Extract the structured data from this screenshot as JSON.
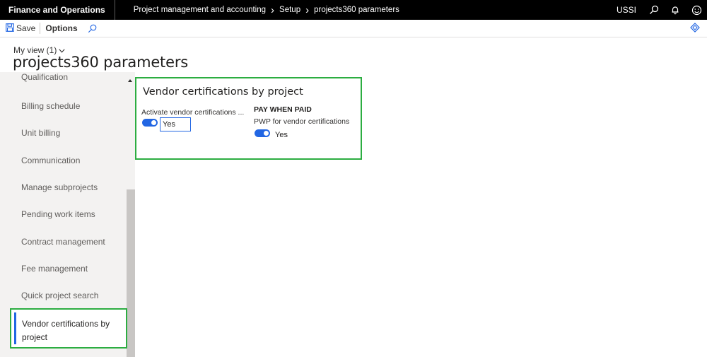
{
  "topbar": {
    "app_name": "Finance and Operations",
    "breadcrumb": [
      "Project management and accounting",
      "Setup",
      "projects360 parameters"
    ],
    "company": "USSI",
    "icons": [
      "search-icon",
      "bell-icon",
      "smiley-icon"
    ]
  },
  "actions": {
    "save_label": "Save",
    "options_label": "Options",
    "icons": [
      "save-icon",
      "search-icon",
      "diamond-icon"
    ]
  },
  "view": {
    "label": "My view (1)"
  },
  "page": {
    "title": "projects360 parameters"
  },
  "nav": {
    "items": [
      {
        "label": "Qualification"
      },
      {
        "label": "Billing schedule"
      },
      {
        "label": "Unit billing"
      },
      {
        "label": "Communication"
      },
      {
        "label": "Manage subprojects"
      },
      {
        "label": "Pending work items"
      },
      {
        "label": "Contract management"
      },
      {
        "label": "Fee management"
      },
      {
        "label": "Quick project search"
      }
    ],
    "selected_label": "Vendor certifications by project"
  },
  "section": {
    "title": "Vendor certifications by project",
    "field1_label": "Activate vendor certifications ...",
    "field1_value": "Yes",
    "group_heading": "PAY WHEN PAID",
    "field2_label": "PWP for vendor certifications",
    "field2_value": "Yes"
  },
  "colors": {
    "accent": "#2266e3",
    "highlight": "#2cad41",
    "topbar": "#000000"
  }
}
